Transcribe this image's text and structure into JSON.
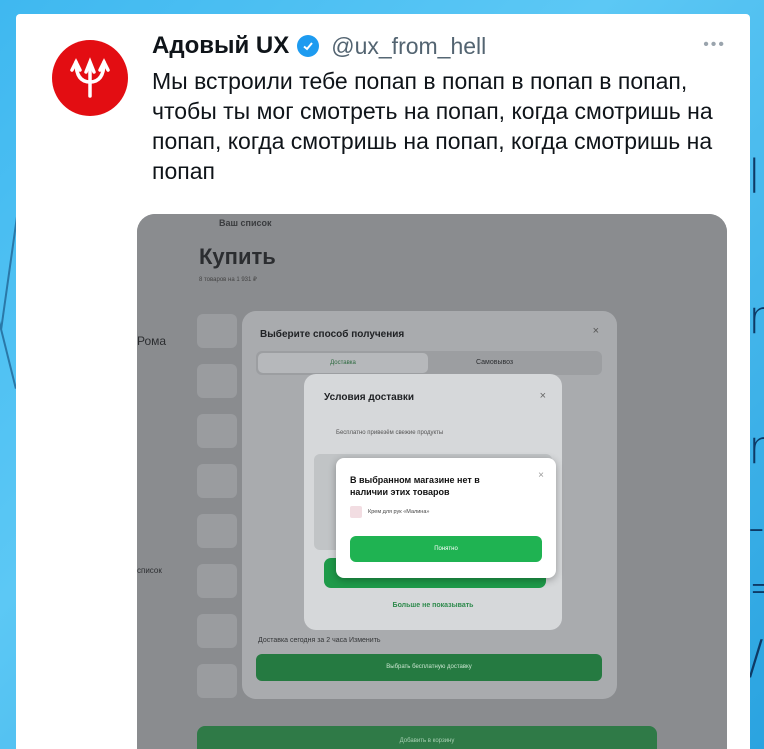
{
  "tweet": {
    "author_name": "Адовый UX",
    "handle": "@ux_from_hell",
    "text": "Мы встроили тебе попап в попап в попап в попап, чтобы ты мог смотреть на попап, когда смотришь на попап, когда смотришь на попап, когда смотришь на попап",
    "more_icon": "ellipsis-icon",
    "verified_icon": "verified-badge-icon",
    "avatar_icon": "trident-icon",
    "colors": {
      "avatar": "#e30d12",
      "verified": "#1d9bf0",
      "background": "#3fb8f0"
    }
  },
  "screenshot": {
    "breadcrumb": "Ваш список",
    "page_title": "Купить",
    "page_subtitle": "8 товаров на 1 931 ₽",
    "left_labels": [
      "Рома",
      "список"
    ],
    "popup_delivery_method": {
      "title": "Выберите способ получения",
      "tab_delivery": "Доставка",
      "tab_pickup": "Самовывоз",
      "footer_text": "Доставка сегодня за 2 часа  Изменить",
      "button": "Выбрать бесплатную доставку"
    },
    "popup_delivery_terms": {
      "title": "Условия доставки",
      "info": "Бесплатно привезём свежие продукты",
      "button": "Понятно",
      "link": "Больше не показывать"
    },
    "popup_out_of_stock": {
      "title": "В выбранном магазине нет в наличии этих товаров",
      "item": "Крем для рук «Малина»",
      "button": "Понятно"
    },
    "bottom_button": "Добавить в корзину"
  }
}
